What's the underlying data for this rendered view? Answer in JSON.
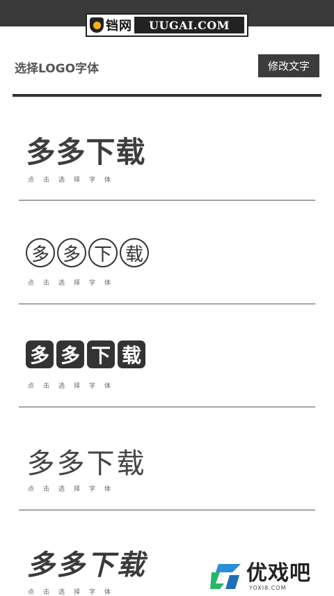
{
  "header": {
    "logo_cn": "铛网",
    "logo_domain": "UUGAI.COM",
    "title": "选择LOGO字体",
    "modify_button": "修改文字"
  },
  "fonts": [
    {
      "chars": [
        "多",
        "多",
        "下",
        "载"
      ],
      "hint": "点击选择字体"
    },
    {
      "chars": [
        "多",
        "多",
        "下",
        "载"
      ],
      "hint": "点击选择字体"
    },
    {
      "chars": [
        "多",
        "多",
        "下",
        "载"
      ],
      "hint": "点击选择字体"
    },
    {
      "chars": [
        "多",
        "多",
        "下",
        "载"
      ],
      "hint": "点击选择字体"
    },
    {
      "chars": [
        "多",
        "多",
        "下",
        "载"
      ],
      "hint": "点击选择字体"
    }
  ],
  "watermark": {
    "name": "优戏吧",
    "domain": "YOXI8.COM"
  }
}
